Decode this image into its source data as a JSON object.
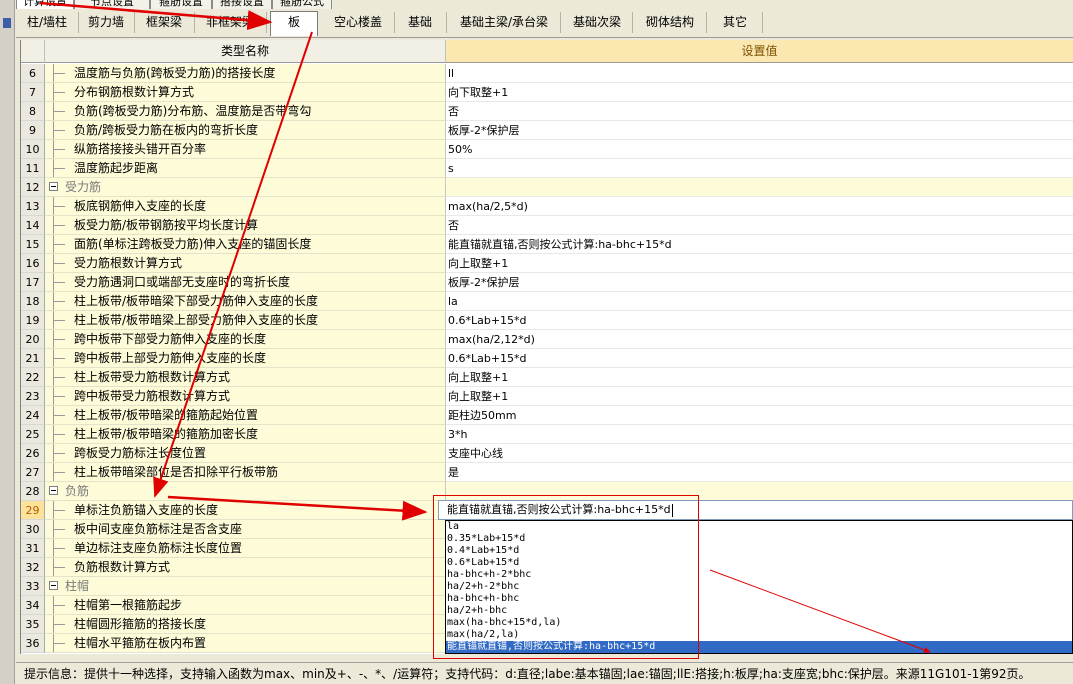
{
  "top_tabs": [
    "计算设置",
    "节点设置",
    "箍筋设置",
    "搭接设置",
    "箍筋公式"
  ],
  "tabs": [
    "柱/墙柱",
    "剪力墙",
    "框架梁",
    "非框架梁",
    "板",
    "空心楼盖",
    "基础",
    "基础主梁/承台梁",
    "基础次梁",
    "砌体结构",
    "其它"
  ],
  "active_tab": "板",
  "table": {
    "col_name": "类型名称",
    "col_value": "设置值",
    "rows": [
      {
        "num": "6",
        "name": "温度筋与负筋(跨板受力筋)的搭接长度",
        "value": "ll"
      },
      {
        "num": "7",
        "name": "分布钢筋根数计算方式",
        "value": "向下取整+1"
      },
      {
        "num": "8",
        "name": "负筋(跨板受力筋)分布筋、温度筋是否带弯勾",
        "value": "否"
      },
      {
        "num": "9",
        "name": "负筋/跨板受力筋在板内的弯折长度",
        "value": "板厚-2*保护层"
      },
      {
        "num": "10",
        "name": "纵筋搭接接头错开百分率",
        "value": "50%"
      },
      {
        "num": "11",
        "name": "温度筋起步距离",
        "value": "s"
      },
      {
        "num": "12",
        "name": "受力筋",
        "value": "",
        "group": true
      },
      {
        "num": "13",
        "name": "板底钢筋伸入支座的长度",
        "value": "max(ha/2,5*d)"
      },
      {
        "num": "14",
        "name": "板受力筋/板带钢筋按平均长度计算",
        "value": "否"
      },
      {
        "num": "15",
        "name": "面筋(单标注跨板受力筋)伸入支座的锚固长度",
        "value": "能直锚就直锚,否则按公式计算:ha-bhc+15*d"
      },
      {
        "num": "16",
        "name": "受力筋根数计算方式",
        "value": "向上取整+1"
      },
      {
        "num": "17",
        "name": "受力筋遇洞口或端部无支座时的弯折长度",
        "value": "板厚-2*保护层"
      },
      {
        "num": "18",
        "name": "柱上板带/板带暗梁下部受力筋伸入支座的长度",
        "value": "la"
      },
      {
        "num": "19",
        "name": "柱上板带/板带暗梁上部受力筋伸入支座的长度",
        "value": "0.6*Lab+15*d"
      },
      {
        "num": "20",
        "name": "跨中板带下部受力筋伸入支座的长度",
        "value": "max(ha/2,12*d)"
      },
      {
        "num": "21",
        "name": "跨中板带上部受力筋伸入支座的长度",
        "value": "0.6*Lab+15*d"
      },
      {
        "num": "22",
        "name": "柱上板带受力筋根数计算方式",
        "value": "向上取整+1"
      },
      {
        "num": "23",
        "name": "跨中板带受力筋根数计算方式",
        "value": "向上取整+1"
      },
      {
        "num": "24",
        "name": "柱上板带/板带暗梁的箍筋起始位置",
        "value": "距柱边50mm"
      },
      {
        "num": "25",
        "name": "柱上板带/板带暗梁的箍筋加密长度",
        "value": "3*h"
      },
      {
        "num": "26",
        "name": "跨板受力筋标注长度位置",
        "value": "支座中心线"
      },
      {
        "num": "27",
        "name": "柱上板带暗梁部位是否扣除平行板带筋",
        "value": "是"
      },
      {
        "num": "28",
        "name": "负筋",
        "value": "",
        "group": true
      },
      {
        "num": "29",
        "name": "单标注负筋锚入支座的长度",
        "value": "",
        "current": true
      },
      {
        "num": "30",
        "name": "板中间支座负筋标注是否含支座",
        "value": ""
      },
      {
        "num": "31",
        "name": "单边标注支座负筋标注长度位置",
        "value": ""
      },
      {
        "num": "32",
        "name": "负筋根数计算方式",
        "value": ""
      },
      {
        "num": "33",
        "name": "柱帽",
        "value": "",
        "group": true
      },
      {
        "num": "34",
        "name": "柱帽第一根箍筋起步",
        "value": ""
      },
      {
        "num": "35",
        "name": "柱帽圆形箍筋的搭接长度",
        "value": ""
      },
      {
        "num": "36",
        "name": "柱帽水平箍筋在板内布置",
        "value": ""
      }
    ]
  },
  "editor": {
    "value": "能直锚就直锚,否则按公式计算:ha-bhc+15*d"
  },
  "dropdown": {
    "options": [
      "la",
      "0.35*Lab+15*d",
      "0.4*Lab+15*d",
      "0.6*Lab+15*d",
      "ha-bhc+h-2*bhc",
      "ha/2+h-2*bhc",
      "ha-bhc+h-bhc",
      "ha/2+h-bhc",
      "max(ha-bhc+15*d,la)",
      "max(ha/2,la)",
      "能直锚就直锚,否则按公式计算:ha-bhc+15*d"
    ],
    "selected_index": 10
  },
  "status": "提示信息：提供十一种选择，支持输入函数为max、min及+、-、*、/运算符；支持代码：d:直径;labe:基本锚固;lae:锚固;llE:搭接;h:板厚;ha:支座宽;bhc:保护层。来源11G101-1第92页。",
  "colors": {
    "annotation": "#e00000",
    "header_value_bg": "#fbe7b0",
    "name_bg": "#fdfbd8",
    "selection": "#316ac5"
  }
}
